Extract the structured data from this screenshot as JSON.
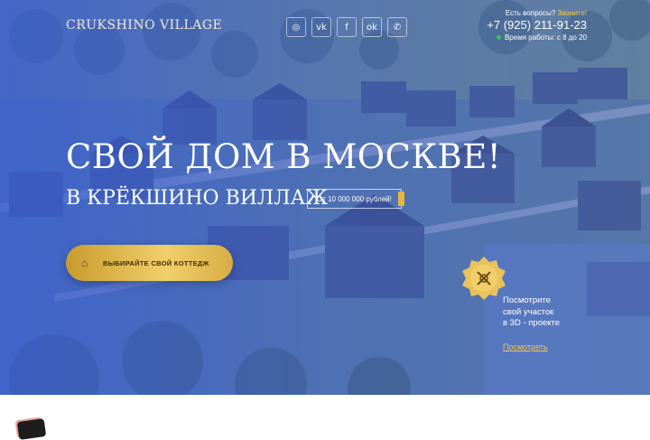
{
  "header": {
    "logo": "CRUKSHINO VILLAGE",
    "socials": [
      {
        "icon": "instagram-icon",
        "glyph": "◎"
      },
      {
        "icon": "vk-icon",
        "glyph": "vk"
      },
      {
        "icon": "facebook-icon",
        "glyph": "f"
      },
      {
        "icon": "odnoklassniki-icon",
        "glyph": "ok"
      },
      {
        "icon": "viber-icon",
        "glyph": "✆"
      }
    ],
    "contact": {
      "question": "Есть вопросы?",
      "call": "Звоните!",
      "phone": "+7 (925) 211-91-23",
      "hours": "Время работы: с 8 до 20"
    }
  },
  "hero": {
    "title": "СВОЙ ДОМ В МОСКВЕ!",
    "subtitle": "В КРЁКШИНО ВИЛЛАЖ",
    "price": "От 10 000 000 рублей!",
    "cta_label": "ВЫБИРАЙТЕ СВОЙ КОТТЕДЖ"
  },
  "panel": {
    "text_lines": [
      "Посмотрите",
      "свой участок",
      "в 3D - проекте"
    ],
    "link": "Посмотреть"
  },
  "colors": {
    "accent_gold": "#e5b73f",
    "overlay_blue": "#3a5fdc",
    "online_green": "#2ec45a"
  }
}
